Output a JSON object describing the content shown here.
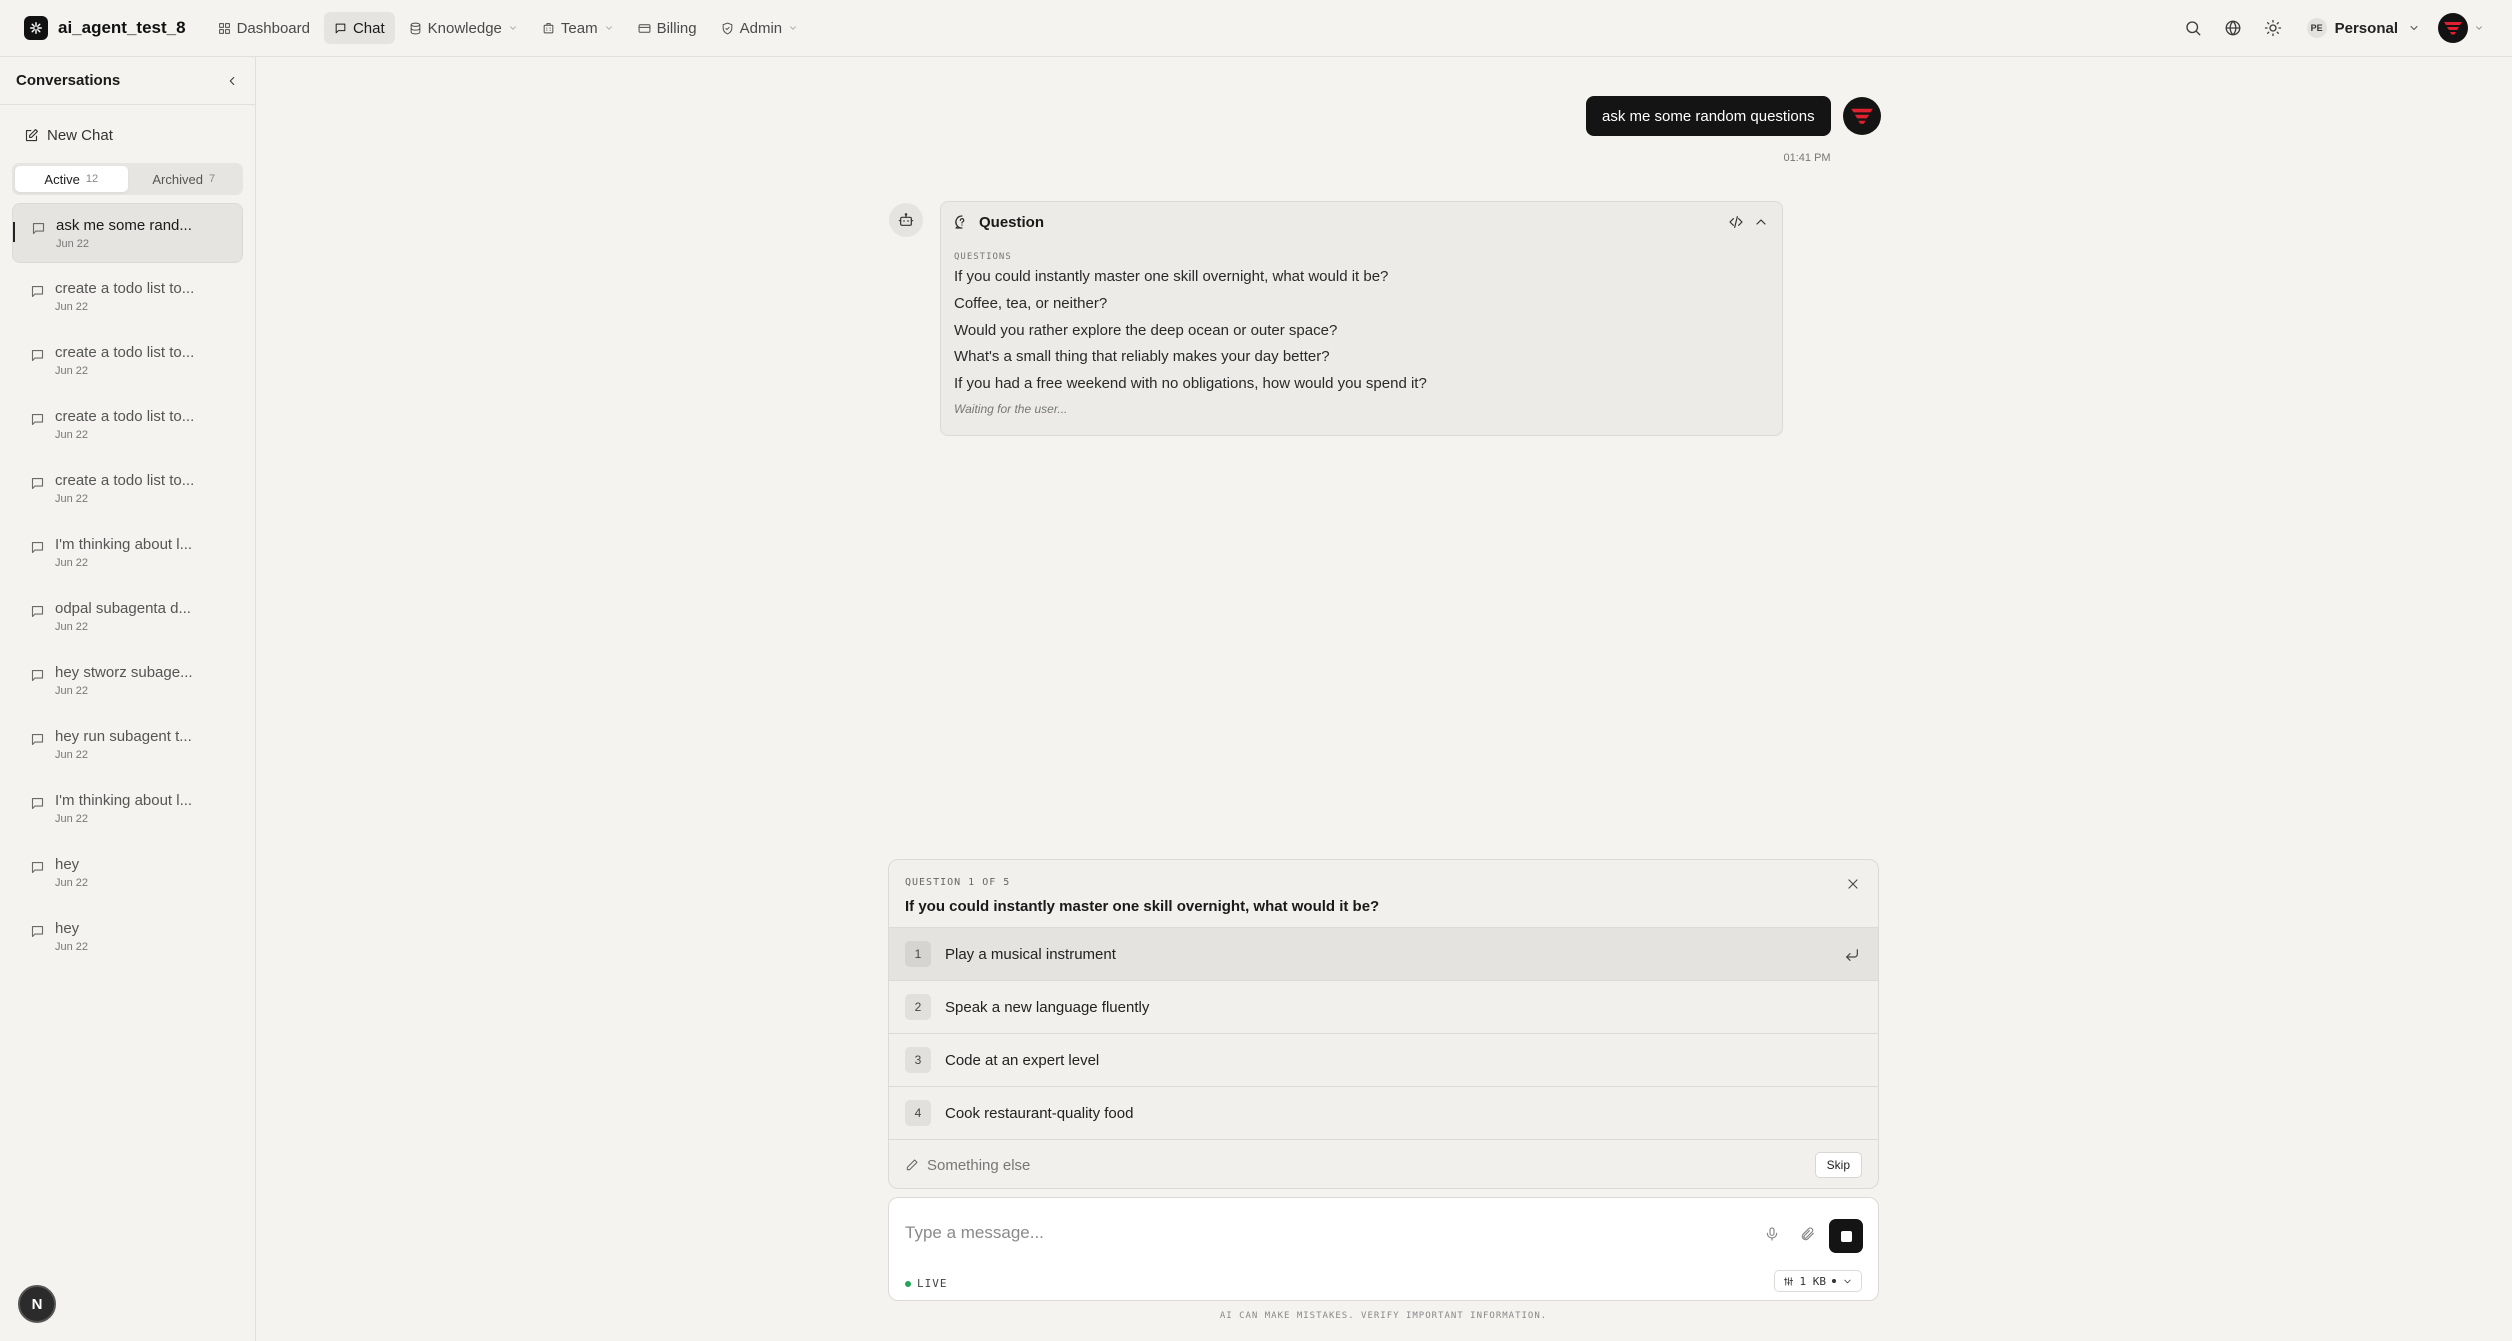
{
  "app": {
    "name": "ai_agent_test_8"
  },
  "nav": {
    "items": [
      {
        "label": "Dashboard",
        "icon": "grid-icon",
        "active": false,
        "has_dropdown": false
      },
      {
        "label": "Chat",
        "icon": "chat-icon",
        "active": true,
        "has_dropdown": false
      },
      {
        "label": "Knowledge",
        "icon": "database-icon",
        "active": false,
        "has_dropdown": true
      },
      {
        "label": "Team",
        "icon": "team-icon",
        "active": false,
        "has_dropdown": true
      },
      {
        "label": "Billing",
        "icon": "card-icon",
        "active": false,
        "has_dropdown": false
      },
      {
        "label": "Admin",
        "icon": "shield-icon",
        "active": false,
        "has_dropdown": true
      }
    ]
  },
  "workspace": {
    "badge": "PE",
    "name": "Personal"
  },
  "sidebar": {
    "title": "Conversations",
    "new_chat": "New Chat",
    "tabs": {
      "active": {
        "label": "Active",
        "count": "12"
      },
      "archived": {
        "label": "Archived",
        "count": "7"
      }
    },
    "conversations": [
      {
        "title": "ask me some rand...",
        "date": "Jun 22"
      },
      {
        "title": "create a todo list to...",
        "date": "Jun 22"
      },
      {
        "title": "create a todo list to...",
        "date": "Jun 22"
      },
      {
        "title": "create a todo list to...",
        "date": "Jun 22"
      },
      {
        "title": "create a todo list to...",
        "date": "Jun 22"
      },
      {
        "title": "I'm thinking about l...",
        "date": "Jun 22"
      },
      {
        "title": "odpal subagenta d...",
        "date": "Jun 22"
      },
      {
        "title": "hey stworz subage...",
        "date": "Jun 22"
      },
      {
        "title": "hey run subagent t...",
        "date": "Jun 22"
      },
      {
        "title": "I'm thinking about l...",
        "date": "Jun 22"
      },
      {
        "title": "hey",
        "date": "Jun 22"
      },
      {
        "title": "hey",
        "date": "Jun 22"
      }
    ],
    "fab_letter": "N"
  },
  "chat": {
    "user_message": {
      "text": "ask me some random questions",
      "time": "01:41 PM"
    },
    "question_card": {
      "title": "Question",
      "section_label": "QUESTIONS",
      "questions": [
        "If you could instantly master one skill overnight, what would it be?",
        "Coffee, tea, or neither?",
        "Would you rather explore the deep ocean or outer space?",
        "What's a small thing that reliably makes your day better?",
        "If you had a free weekend with no obligations, how would you spend it?"
      ],
      "status": "Waiting for the user..."
    }
  },
  "question_panel": {
    "counter": "QUESTION 1 OF 5",
    "question": "If you could instantly master one skill overnight, what would it be?",
    "options": [
      {
        "num": "1",
        "label": "Play a musical instrument"
      },
      {
        "num": "2",
        "label": "Speak a new language fluently"
      },
      {
        "num": "3",
        "label": "Code at an expert level"
      },
      {
        "num": "4",
        "label": "Cook restaurant-quality food"
      }
    ],
    "something_else": "Something else",
    "skip": "Skip"
  },
  "composer": {
    "placeholder": "Type a message...",
    "live_label": "LIVE",
    "size_label": "1 KB"
  },
  "disclaimer": "AI CAN MAKE MISTAKES. VERIFY IMPORTANT INFORMATION.",
  "colors": {
    "accent": "#141414",
    "live": "#22a55a",
    "brand_red": "#e0202f"
  }
}
